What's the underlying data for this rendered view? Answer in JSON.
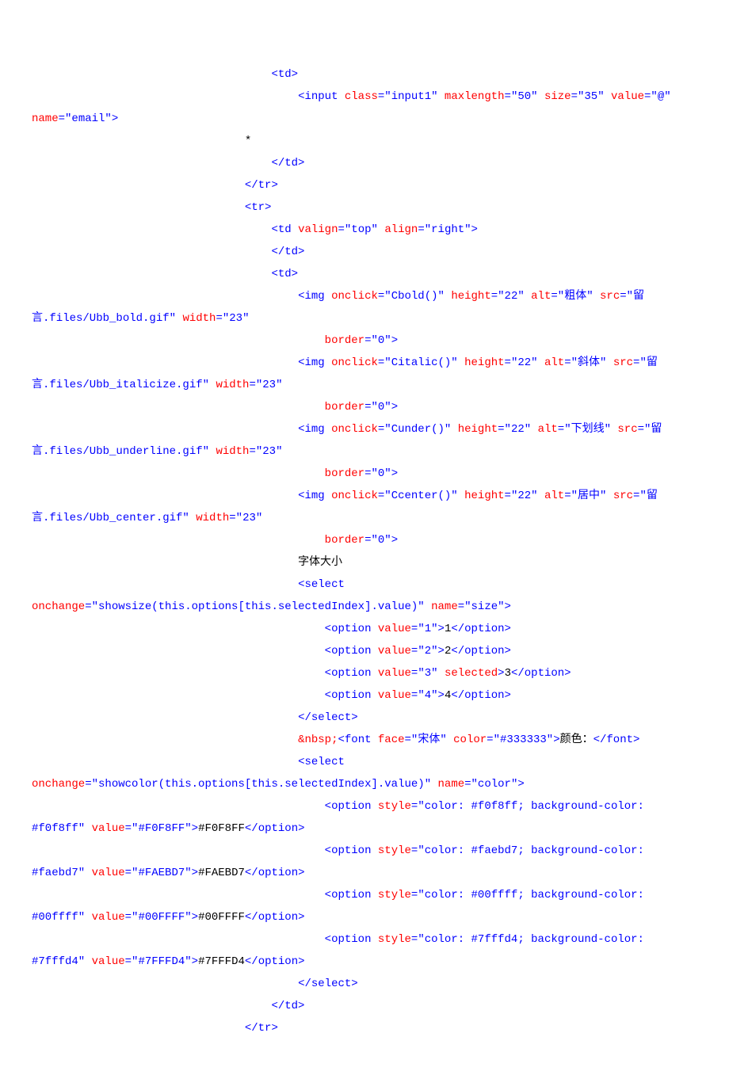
{
  "lines": [
    [
      {
        "indent": 36
      },
      {
        "t": "tag",
        "v": "<td>"
      }
    ],
    [
      {
        "indent": 40
      },
      {
        "t": "tag",
        "v": "<input "
      },
      {
        "t": "attr-name",
        "v": "class"
      },
      {
        "t": "eq",
        "v": "="
      },
      {
        "t": "attr-val",
        "v": "\"input1\""
      },
      {
        "t": "tag",
        "v": " "
      },
      {
        "t": "attr-name",
        "v": "maxlength"
      },
      {
        "t": "eq",
        "v": "="
      },
      {
        "t": "attr-val",
        "v": "\"50\""
      },
      {
        "t": "tag",
        "v": " "
      },
      {
        "t": "attr-name",
        "v": "size"
      },
      {
        "t": "eq",
        "v": "="
      },
      {
        "t": "attr-val",
        "v": "\"35\""
      },
      {
        "t": "tag",
        "v": " "
      },
      {
        "t": "attr-name",
        "v": "value"
      },
      {
        "t": "eq",
        "v": "="
      },
      {
        "t": "attr-val",
        "v": "\"@\""
      }
    ],
    [
      {
        "indent": 0
      },
      {
        "t": "attr-name",
        "v": "name"
      },
      {
        "t": "eq",
        "v": "="
      },
      {
        "t": "attr-val",
        "v": "\"email\""
      },
      {
        "t": "tag",
        "v": ">"
      }
    ],
    [
      {
        "indent": 32
      },
      {
        "t": "txt",
        "v": "*"
      }
    ],
    [
      {
        "indent": 36
      },
      {
        "t": "tag",
        "v": "</td>"
      }
    ],
    [
      {
        "indent": 32
      },
      {
        "t": "tag",
        "v": "</tr>"
      }
    ],
    [
      {
        "indent": 32
      },
      {
        "t": "tag",
        "v": "<tr>"
      }
    ],
    [
      {
        "indent": 36
      },
      {
        "t": "tag",
        "v": "<td "
      },
      {
        "t": "attr-name",
        "v": "valign"
      },
      {
        "t": "eq",
        "v": "="
      },
      {
        "t": "attr-val",
        "v": "\"top\""
      },
      {
        "t": "tag",
        "v": " "
      },
      {
        "t": "attr-name",
        "v": "align"
      },
      {
        "t": "eq",
        "v": "="
      },
      {
        "t": "attr-val",
        "v": "\"right\""
      },
      {
        "t": "tag",
        "v": ">"
      }
    ],
    [
      {
        "indent": 36
      },
      {
        "t": "tag",
        "v": "</td>"
      }
    ],
    [
      {
        "indent": 36
      },
      {
        "t": "tag",
        "v": "<td>"
      }
    ],
    [
      {
        "indent": 40
      },
      {
        "t": "tag",
        "v": "<img "
      },
      {
        "t": "attr-name",
        "v": "onclick"
      },
      {
        "t": "eq",
        "v": "="
      },
      {
        "t": "attr-val",
        "v": "\"Cbold()\""
      },
      {
        "t": "tag",
        "v": " "
      },
      {
        "t": "attr-name",
        "v": "height"
      },
      {
        "t": "eq",
        "v": "="
      },
      {
        "t": "attr-val",
        "v": "\"22\""
      },
      {
        "t": "tag",
        "v": " "
      },
      {
        "t": "attr-name",
        "v": "alt"
      },
      {
        "t": "eq",
        "v": "="
      },
      {
        "t": "attr-val",
        "v": "\"粗体\""
      },
      {
        "t": "tag",
        "v": " "
      },
      {
        "t": "attr-name",
        "v": "src"
      },
      {
        "t": "eq",
        "v": "="
      },
      {
        "t": "attr-val",
        "v": "\"留"
      }
    ],
    [
      {
        "indent": 0
      },
      {
        "t": "attr-val",
        "v": "言.files/Ubb_bold.gif\""
      },
      {
        "t": "tag",
        "v": " "
      },
      {
        "t": "attr-name",
        "v": "width"
      },
      {
        "t": "eq",
        "v": "="
      },
      {
        "t": "attr-val",
        "v": "\"23\""
      }
    ],
    [
      {
        "indent": 44
      },
      {
        "t": "attr-name",
        "v": "border"
      },
      {
        "t": "eq",
        "v": "="
      },
      {
        "t": "attr-val",
        "v": "\"0\""
      },
      {
        "t": "tag",
        "v": ">"
      }
    ],
    [
      {
        "indent": 40
      },
      {
        "t": "tag",
        "v": "<img "
      },
      {
        "t": "attr-name",
        "v": "onclick"
      },
      {
        "t": "eq",
        "v": "="
      },
      {
        "t": "attr-val",
        "v": "\"Citalic()\""
      },
      {
        "t": "tag",
        "v": " "
      },
      {
        "t": "attr-name",
        "v": "height"
      },
      {
        "t": "eq",
        "v": "="
      },
      {
        "t": "attr-val",
        "v": "\"22\""
      },
      {
        "t": "tag",
        "v": " "
      },
      {
        "t": "attr-name",
        "v": "alt"
      },
      {
        "t": "eq",
        "v": "="
      },
      {
        "t": "attr-val",
        "v": "\"斜体\""
      },
      {
        "t": "tag",
        "v": " "
      },
      {
        "t": "attr-name",
        "v": "src"
      },
      {
        "t": "eq",
        "v": "="
      },
      {
        "t": "attr-val",
        "v": "\"留"
      }
    ],
    [
      {
        "indent": 0
      },
      {
        "t": "attr-val",
        "v": "言.files/Ubb_italicize.gif\""
      },
      {
        "t": "tag",
        "v": " "
      },
      {
        "t": "attr-name",
        "v": "width"
      },
      {
        "t": "eq",
        "v": "="
      },
      {
        "t": "attr-val",
        "v": "\"23\""
      }
    ],
    [
      {
        "indent": 44
      },
      {
        "t": "attr-name",
        "v": "border"
      },
      {
        "t": "eq",
        "v": "="
      },
      {
        "t": "attr-val",
        "v": "\"0\""
      },
      {
        "t": "tag",
        "v": ">"
      }
    ],
    [
      {
        "indent": 40
      },
      {
        "t": "tag",
        "v": "<img "
      },
      {
        "t": "attr-name",
        "v": "onclick"
      },
      {
        "t": "eq",
        "v": "="
      },
      {
        "t": "attr-val",
        "v": "\"Cunder()\""
      },
      {
        "t": "tag",
        "v": " "
      },
      {
        "t": "attr-name",
        "v": "height"
      },
      {
        "t": "eq",
        "v": "="
      },
      {
        "t": "attr-val",
        "v": "\"22\""
      },
      {
        "t": "tag",
        "v": " "
      },
      {
        "t": "attr-name",
        "v": "alt"
      },
      {
        "t": "eq",
        "v": "="
      },
      {
        "t": "attr-val",
        "v": "\"下划线\""
      },
      {
        "t": "tag",
        "v": " "
      },
      {
        "t": "attr-name",
        "v": "src"
      },
      {
        "t": "eq",
        "v": "="
      },
      {
        "t": "attr-val",
        "v": "\"留"
      }
    ],
    [
      {
        "indent": 0
      },
      {
        "t": "attr-val",
        "v": "言.files/Ubb_underline.gif\""
      },
      {
        "t": "tag",
        "v": " "
      },
      {
        "t": "attr-name",
        "v": "width"
      },
      {
        "t": "eq",
        "v": "="
      },
      {
        "t": "attr-val",
        "v": "\"23\""
      }
    ],
    [
      {
        "indent": 44
      },
      {
        "t": "attr-name",
        "v": "border"
      },
      {
        "t": "eq",
        "v": "="
      },
      {
        "t": "attr-val",
        "v": "\"0\""
      },
      {
        "t": "tag",
        "v": ">"
      }
    ],
    [
      {
        "indent": 40
      },
      {
        "t": "tag",
        "v": "<img "
      },
      {
        "t": "attr-name",
        "v": "onclick"
      },
      {
        "t": "eq",
        "v": "="
      },
      {
        "t": "attr-val",
        "v": "\"Ccenter()\""
      },
      {
        "t": "tag",
        "v": " "
      },
      {
        "t": "attr-name",
        "v": "height"
      },
      {
        "t": "eq",
        "v": "="
      },
      {
        "t": "attr-val",
        "v": "\"22\""
      },
      {
        "t": "tag",
        "v": " "
      },
      {
        "t": "attr-name",
        "v": "alt"
      },
      {
        "t": "eq",
        "v": "="
      },
      {
        "t": "attr-val",
        "v": "\"居中\""
      },
      {
        "t": "tag",
        "v": " "
      },
      {
        "t": "attr-name",
        "v": "src"
      },
      {
        "t": "eq",
        "v": "="
      },
      {
        "t": "attr-val",
        "v": "\"留"
      }
    ],
    [
      {
        "indent": 0
      },
      {
        "t": "attr-val",
        "v": "言.files/Ubb_center.gif\""
      },
      {
        "t": "tag",
        "v": " "
      },
      {
        "t": "attr-name",
        "v": "width"
      },
      {
        "t": "eq",
        "v": "="
      },
      {
        "t": "attr-val",
        "v": "\"23\""
      }
    ],
    [
      {
        "indent": 44
      },
      {
        "t": "attr-name",
        "v": "border"
      },
      {
        "t": "eq",
        "v": "="
      },
      {
        "t": "attr-val",
        "v": "\"0\""
      },
      {
        "t": "tag",
        "v": ">"
      }
    ],
    [
      {
        "indent": 40
      },
      {
        "t": "txt",
        "v": "字体大小"
      }
    ],
    [
      {
        "indent": 40
      },
      {
        "t": "tag",
        "v": "<select"
      }
    ],
    [
      {
        "indent": 0
      },
      {
        "t": "attr-name",
        "v": "onchange"
      },
      {
        "t": "eq",
        "v": "="
      },
      {
        "t": "attr-val",
        "v": "\"showsize(this.options[this.selectedIndex].value)\""
      },
      {
        "t": "tag",
        "v": " "
      },
      {
        "t": "attr-name",
        "v": "name"
      },
      {
        "t": "eq",
        "v": "="
      },
      {
        "t": "attr-val",
        "v": "\"size\""
      },
      {
        "t": "tag",
        "v": ">"
      }
    ],
    [
      {
        "indent": 44
      },
      {
        "t": "tag",
        "v": "<option "
      },
      {
        "t": "attr-name",
        "v": "value"
      },
      {
        "t": "eq",
        "v": "="
      },
      {
        "t": "attr-val",
        "v": "\"1\""
      },
      {
        "t": "tag",
        "v": ">"
      },
      {
        "t": "txt",
        "v": "1"
      },
      {
        "t": "tag",
        "v": "</option>"
      }
    ],
    [
      {
        "indent": 44
      },
      {
        "t": "tag",
        "v": "<option "
      },
      {
        "t": "attr-name",
        "v": "value"
      },
      {
        "t": "eq",
        "v": "="
      },
      {
        "t": "attr-val",
        "v": "\"2\""
      },
      {
        "t": "tag",
        "v": ">"
      },
      {
        "t": "txt",
        "v": "2"
      },
      {
        "t": "tag",
        "v": "</option>"
      }
    ],
    [
      {
        "indent": 44
      },
      {
        "t": "tag",
        "v": "<option "
      },
      {
        "t": "attr-name",
        "v": "value"
      },
      {
        "t": "eq",
        "v": "="
      },
      {
        "t": "attr-val",
        "v": "\"3\""
      },
      {
        "t": "tag",
        "v": " "
      },
      {
        "t": "attr-name",
        "v": "selected"
      },
      {
        "t": "tag",
        "v": ">"
      },
      {
        "t": "txt",
        "v": "3"
      },
      {
        "t": "tag",
        "v": "</option>"
      }
    ],
    [
      {
        "indent": 44
      },
      {
        "t": "tag",
        "v": "<option "
      },
      {
        "t": "attr-name",
        "v": "value"
      },
      {
        "t": "eq",
        "v": "="
      },
      {
        "t": "attr-val",
        "v": "\"4\""
      },
      {
        "t": "tag",
        "v": ">"
      },
      {
        "t": "txt",
        "v": "4"
      },
      {
        "t": "tag",
        "v": "</option>"
      }
    ],
    [
      {
        "indent": 40
      },
      {
        "t": "tag",
        "v": "</select>"
      }
    ],
    [
      {
        "indent": 40
      },
      {
        "t": "attr-name",
        "v": "&nbsp;"
      },
      {
        "t": "tag",
        "v": "<font "
      },
      {
        "t": "attr-name",
        "v": "face"
      },
      {
        "t": "eq",
        "v": "="
      },
      {
        "t": "attr-val",
        "v": "\"宋体\""
      },
      {
        "t": "tag",
        "v": " "
      },
      {
        "t": "attr-name",
        "v": "color"
      },
      {
        "t": "eq",
        "v": "="
      },
      {
        "t": "attr-val",
        "v": "\"#333333\""
      },
      {
        "t": "tag",
        "v": ">"
      },
      {
        "t": "txt",
        "v": "颜色："
      },
      {
        "t": "tag",
        "v": "</font>"
      }
    ],
    [
      {
        "indent": 40
      },
      {
        "t": "tag",
        "v": "<select"
      }
    ],
    [
      {
        "indent": 0
      },
      {
        "t": "attr-name",
        "v": "onchange"
      },
      {
        "t": "eq",
        "v": "="
      },
      {
        "t": "attr-val",
        "v": "\"showcolor(this.options[this.selectedIndex].value)\""
      },
      {
        "t": "tag",
        "v": " "
      },
      {
        "t": "attr-name",
        "v": "name"
      },
      {
        "t": "eq",
        "v": "="
      },
      {
        "t": "attr-val",
        "v": "\"color\""
      },
      {
        "t": "tag",
        "v": ">"
      }
    ],
    [
      {
        "indent": 44
      },
      {
        "t": "tag",
        "v": "<option "
      },
      {
        "t": "attr-name",
        "v": "style"
      },
      {
        "t": "eq",
        "v": "="
      },
      {
        "t": "attr-val",
        "v": "\"color: #f0f8ff; background-color:"
      }
    ],
    [
      {
        "indent": 0
      },
      {
        "t": "attr-val",
        "v": "#f0f8ff\""
      },
      {
        "t": "tag",
        "v": " "
      },
      {
        "t": "attr-name",
        "v": "value"
      },
      {
        "t": "eq",
        "v": "="
      },
      {
        "t": "attr-val",
        "v": "\"#F0F8FF\""
      },
      {
        "t": "tag",
        "v": ">"
      },
      {
        "t": "txt",
        "v": "#F0F8FF"
      },
      {
        "t": "tag",
        "v": "</option>"
      }
    ],
    [
      {
        "indent": 44
      },
      {
        "t": "tag",
        "v": "<option "
      },
      {
        "t": "attr-name",
        "v": "style"
      },
      {
        "t": "eq",
        "v": "="
      },
      {
        "t": "attr-val",
        "v": "\"color: #faebd7; background-color:"
      }
    ],
    [
      {
        "indent": 0
      },
      {
        "t": "attr-val",
        "v": "#faebd7\""
      },
      {
        "t": "tag",
        "v": " "
      },
      {
        "t": "attr-name",
        "v": "value"
      },
      {
        "t": "eq",
        "v": "="
      },
      {
        "t": "attr-val",
        "v": "\"#FAEBD7\""
      },
      {
        "t": "tag",
        "v": ">"
      },
      {
        "t": "txt",
        "v": "#FAEBD7"
      },
      {
        "t": "tag",
        "v": "</option>"
      }
    ],
    [
      {
        "indent": 44
      },
      {
        "t": "tag",
        "v": "<option "
      },
      {
        "t": "attr-name",
        "v": "style"
      },
      {
        "t": "eq",
        "v": "="
      },
      {
        "t": "attr-val",
        "v": "\"color: #00ffff; background-color:"
      }
    ],
    [
      {
        "indent": 0
      },
      {
        "t": "attr-val",
        "v": "#00ffff\""
      },
      {
        "t": "tag",
        "v": " "
      },
      {
        "t": "attr-name",
        "v": "value"
      },
      {
        "t": "eq",
        "v": "="
      },
      {
        "t": "attr-val",
        "v": "\"#00FFFF\""
      },
      {
        "t": "tag",
        "v": ">"
      },
      {
        "t": "txt",
        "v": "#00FFFF"
      },
      {
        "t": "tag",
        "v": "</option>"
      }
    ],
    [
      {
        "indent": 44
      },
      {
        "t": "tag",
        "v": "<option "
      },
      {
        "t": "attr-name",
        "v": "style"
      },
      {
        "t": "eq",
        "v": "="
      },
      {
        "t": "attr-val",
        "v": "\"color: #7fffd4; background-color:"
      }
    ],
    [
      {
        "indent": 0
      },
      {
        "t": "attr-val",
        "v": "#7fffd4\""
      },
      {
        "t": "tag",
        "v": " "
      },
      {
        "t": "attr-name",
        "v": "value"
      },
      {
        "t": "eq",
        "v": "="
      },
      {
        "t": "attr-val",
        "v": "\"#7FFFD4\""
      },
      {
        "t": "tag",
        "v": ">"
      },
      {
        "t": "txt",
        "v": "#7FFFD4"
      },
      {
        "t": "tag",
        "v": "</option>"
      }
    ],
    [
      {
        "indent": 40
      },
      {
        "t": "tag",
        "v": "</select>"
      }
    ],
    [
      {
        "indent": 36
      },
      {
        "t": "tag",
        "v": "</td>"
      }
    ],
    [
      {
        "indent": 32
      },
      {
        "t": "tag",
        "v": "</tr>"
      }
    ]
  ]
}
